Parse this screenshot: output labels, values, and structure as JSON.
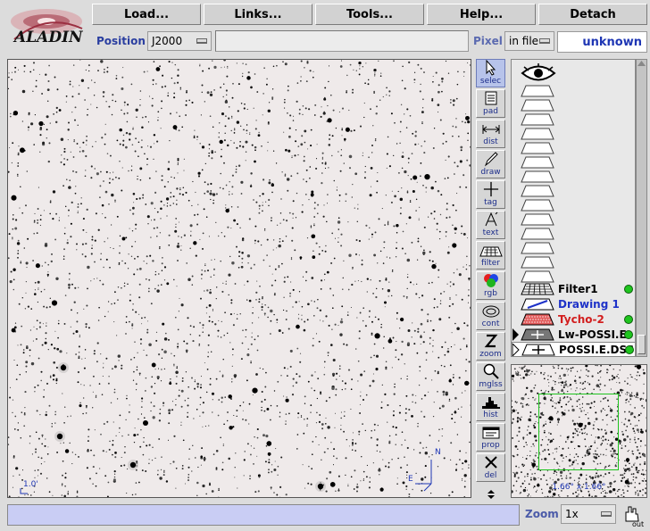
{
  "app": {
    "logo_text": "ALADIN"
  },
  "menu": [
    {
      "label": "Load..."
    },
    {
      "label": "Links..."
    },
    {
      "label": "Tools..."
    },
    {
      "label": "Help..."
    },
    {
      "label": "Detach"
    }
  ],
  "position": {
    "label": "Position",
    "frame": "J2000",
    "value": "",
    "pixel_label": "Pixel",
    "pixel_mode": "in file",
    "pixel_value": "unknown"
  },
  "viewer": {
    "scale_label": "1.0'",
    "compass_n": "N",
    "compass_e": "E"
  },
  "tools": [
    {
      "label": "selec",
      "icon": "arrow-cursor-icon",
      "active": true
    },
    {
      "label": "pad",
      "icon": "notepad-icon"
    },
    {
      "label": "dist",
      "icon": "distance-icon"
    },
    {
      "label": "draw",
      "icon": "pencil-icon"
    },
    {
      "label": "tag",
      "icon": "crosshair-icon"
    },
    {
      "label": "text",
      "icon": "text-icon"
    },
    {
      "label": "filter",
      "icon": "filter-icon"
    },
    {
      "label": "rgb",
      "icon": "rgb-icon"
    },
    {
      "label": "cont",
      "icon": "contour-icon"
    },
    {
      "label": "zoom",
      "icon": "zoom-z-icon"
    },
    {
      "label": "mglss",
      "icon": "magnifier-icon"
    },
    {
      "label": "hist",
      "icon": "histogram-icon"
    },
    {
      "label": "prop",
      "icon": "properties-icon"
    },
    {
      "label": "del",
      "icon": "delete-x-icon"
    }
  ],
  "layers": [
    {
      "name": "Filter1",
      "color": "#000000",
      "dot": true,
      "icon": "filter-layer-icon"
    },
    {
      "name": "Drawing 1",
      "color": "#1e32c8",
      "dot": false,
      "icon": "drawing-layer-icon"
    },
    {
      "name": "Tycho-2",
      "color": "#d21e1e",
      "dot": true,
      "icon": "catalog-layer-icon"
    },
    {
      "name": "Lw-POSSI.E",
      "color": "#000000",
      "dot": true,
      "icon": "image-layer-icon"
    },
    {
      "name": "POSSI.E.DSS",
      "color": "#000000",
      "dot": true,
      "icon": "image-layer-icon"
    }
  ],
  "empty_layer_slots": 14,
  "zoomview": {
    "label": "1.66° x 1.66°"
  },
  "zoom": {
    "label": "Zoom",
    "value": "1x"
  },
  "status": {
    "text": ""
  },
  "out_button": {
    "label": "out"
  }
}
